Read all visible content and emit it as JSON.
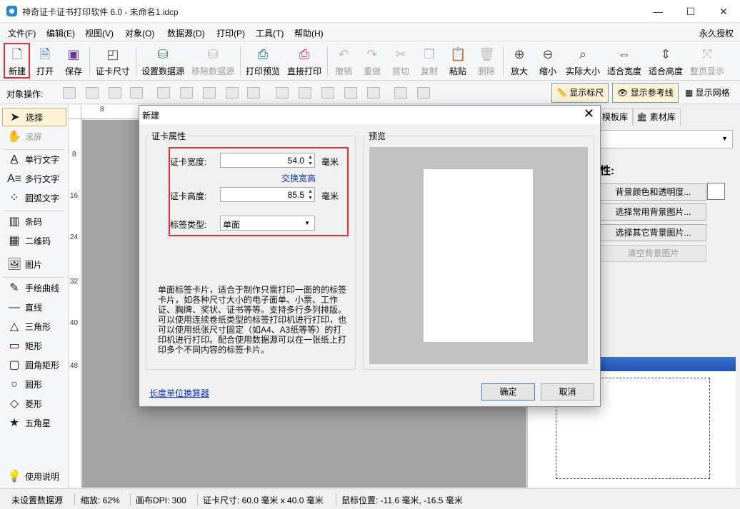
{
  "window": {
    "title": "神奇证卡证书打印软件 6.0 - 未命名1.idcp",
    "minimize": "—",
    "maximize": "☐",
    "close": "✕"
  },
  "menu": {
    "items": [
      "文件(F)",
      "编辑(E)",
      "视图(V)",
      "对象(O)",
      "数据源(D)",
      "打印(P)",
      "工具(T)",
      "帮助(H)"
    ],
    "auth": "永久授权"
  },
  "toolbar": {
    "new": "新建",
    "open": "打开",
    "save": "保存",
    "card_size": "证卡尺寸",
    "set_datasource": "设置数据源",
    "remove_datasource": "移除数据源",
    "print_preview": "打印预览",
    "direct_print": "直接打印",
    "undo": "撤销",
    "redo": "重做",
    "cut": "剪切",
    "copy": "复制",
    "paste": "粘贴",
    "delete": "删除",
    "zoom_in": "放大",
    "zoom_out": "缩小",
    "actual_size": "实际大小",
    "fit_width": "适合宽度",
    "fit_height": "适合高度",
    "full_page": "整页显示"
  },
  "objbar": {
    "label": "对象操作:",
    "show_ruler": "显示标尺",
    "show_guides": "显示参考线",
    "show_grid": "显示网格"
  },
  "tools": {
    "select": "选择",
    "scroll": "滚屏",
    "single_text": "单行文字",
    "multi_text": "多行文字",
    "arc_text": "圆弧文字",
    "barcode": "条码",
    "qrcode": "二维码",
    "image": "图片",
    "freehand": "手绘曲线",
    "line": "直线",
    "triangle": "三角形",
    "rectangle": "矩形",
    "rounded_rect": "圆角矩形",
    "circle": "圆形",
    "diamond": "菱形",
    "star": "五角星",
    "help": "使用说明"
  },
  "ruler": {
    "top": [
      "8"
    ],
    "left": [
      "8",
      "16",
      "24",
      "32",
      "40",
      "48"
    ]
  },
  "right_panel": {
    "tab_templates": "模板库",
    "tab_assets": "素材库",
    "section_label": "性:",
    "bg_color_btn": "背景颜色和透明度...",
    "common_bg_btn": "选择常用背景图片...",
    "other_bg_btn": "选择其它背景图片...",
    "clear_bg_btn": "清空背景图片"
  },
  "status": {
    "datasource": "未设置数据源",
    "zoom": "缩放: 62%",
    "dpi": "画布DPI: 300",
    "card_size": "证卡尺寸: 60.0 毫米 x 40.0 毫米",
    "mouse": "鼠标位置: -11.6 毫米, -16.5 毫米"
  },
  "dialog": {
    "title": "新建",
    "props_group": "证卡属性",
    "width_label": "证卡宽度:",
    "width_value": "54.0",
    "width_unit": "毫米",
    "swap_link": "交换宽高",
    "height_label": "证卡高度:",
    "height_value": "85.5",
    "height_unit": "毫米",
    "type_label": "标签类型:",
    "type_value": "单面",
    "description": "单面标签卡片，适合于制作只需打印一面的的标签卡片，如各种尺寸大小的电子面单、小票、工作证、胸牌、奖状、证书等等。支持多行多列排版。可以使用连续卷纸类型的标签打印机进行打印，也可以使用纸张尺寸固定（如A4、A3纸等等）的打印机进行打印。配合使用数据源可以在一张纸上打印多个不同内容的标签卡片。",
    "preview_group": "预览",
    "unit_calc_link": "长度单位换算器",
    "ok": "确定",
    "cancel": "取消"
  }
}
